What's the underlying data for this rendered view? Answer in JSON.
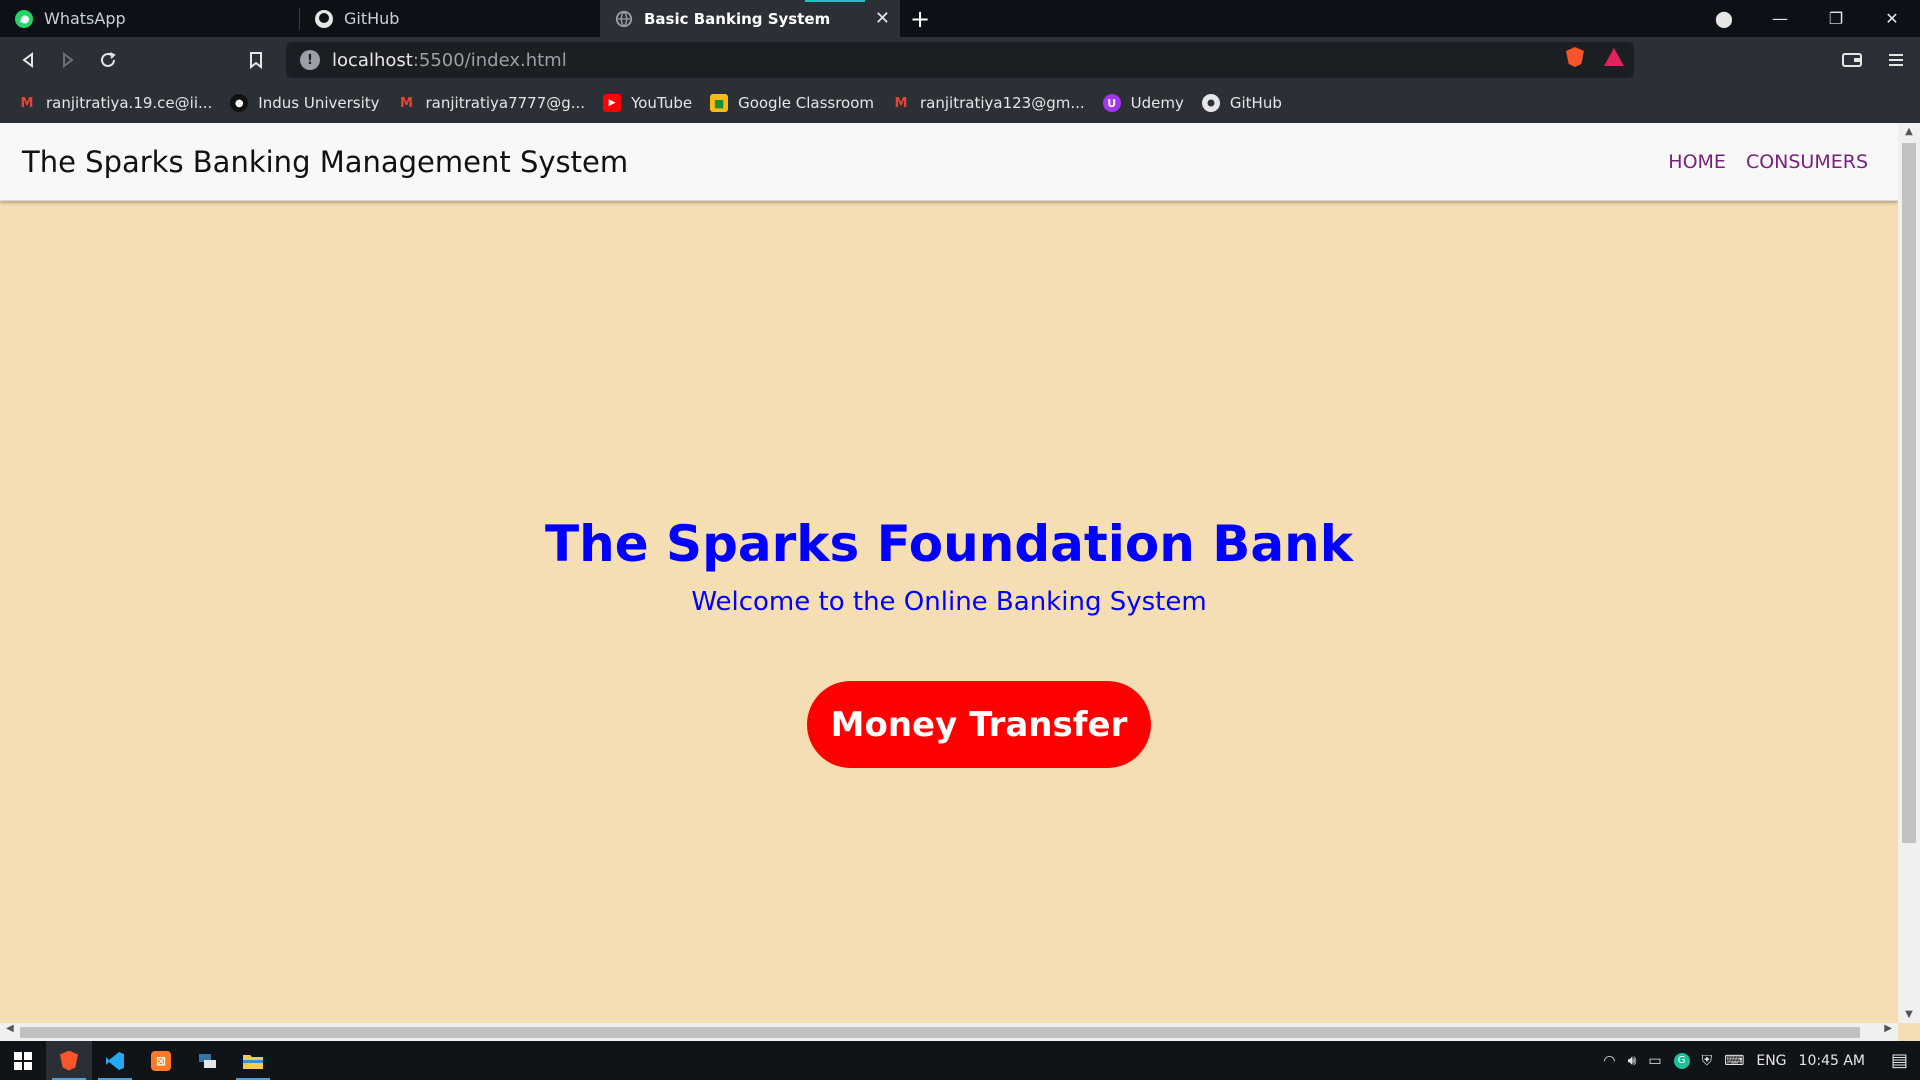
{
  "browser": {
    "tabs": [
      {
        "label": "WhatsApp",
        "icon": "whatsapp-icon"
      },
      {
        "label": "GitHub",
        "icon": "github-icon"
      },
      {
        "label": "Basic Banking System",
        "icon": "globe-icon",
        "active": true
      }
    ],
    "url_host": "localhost",
    "url_path": ":5500/index.html",
    "bookmarks": [
      {
        "label": "ranjitratiya.19.ce@ii...",
        "icon": "gmail-icon"
      },
      {
        "label": "Indus University",
        "icon": "indus-icon"
      },
      {
        "label": "ranjitratiya7777@g...",
        "icon": "gmail-icon"
      },
      {
        "label": "YouTube",
        "icon": "youtube-icon"
      },
      {
        "label": "Google Classroom",
        "icon": "classroom-icon"
      },
      {
        "label": "ranjitratiya123@gm...",
        "icon": "gmail-icon"
      },
      {
        "label": "Udemy",
        "icon": "udemy-icon"
      },
      {
        "label": "GitHub",
        "icon": "github-icon"
      }
    ]
  },
  "page": {
    "brand": "The Sparks Banking Management System",
    "nav": {
      "home": "HOME",
      "consumers": "CONSUMERS"
    },
    "hero_title": "The Sparks Foundation Bank",
    "hero_subtitle": "Welcome to the Online Banking System",
    "cta": "Money Transfer",
    "colors": {
      "background": "#f5deb3",
      "title": "#0000ff",
      "button": "#ff0000",
      "nav_link": "#7a1f7a"
    }
  },
  "taskbar": {
    "language": "ENG",
    "time": "10:45 AM"
  }
}
